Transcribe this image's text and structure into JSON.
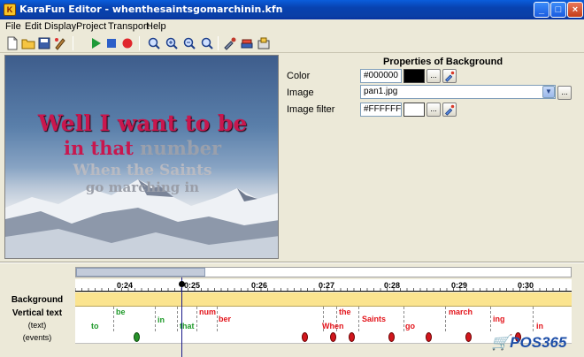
{
  "window": {
    "title": "KaraFun Editor - whenthesaintsgomarchinin.kfn"
  },
  "menu": [
    "File",
    "Edit",
    "Display",
    "Project",
    "Transport",
    "Help"
  ],
  "preview": {
    "line1": "Well I want to be",
    "line2a": "in that ",
    "line2b": "number",
    "line3": "When the Saints",
    "line4": "go marching in"
  },
  "properties": {
    "title": "Properties of Background",
    "color_label": "Color",
    "color_value": "#000000",
    "image_label": "Image",
    "image_value": "pan1.jpg",
    "filter_label": "Image filter",
    "filter_value": "#FFFFFF",
    "ellipsis": "..."
  },
  "timeline": {
    "ticks": [
      "0:24",
      "0:25",
      "0:26",
      "0:27",
      "0:28",
      "0:29",
      "0:30"
    ],
    "rows": {
      "background": "Background",
      "vertical_text": "Vertical text",
      "text": "(text)",
      "events": "(events)"
    },
    "syllables": [
      "be",
      "to",
      "in",
      "that",
      "num",
      "ber",
      "the",
      "When",
      "Saints",
      "go",
      "march",
      "ing",
      "in"
    ]
  },
  "watermark": "POS365",
  "colors": {
    "title_bar": "#0a4fcf",
    "background_track": "#fbe48f",
    "syllable_sung": "#1f9a2a",
    "syllable_pending": "#e3141b"
  }
}
